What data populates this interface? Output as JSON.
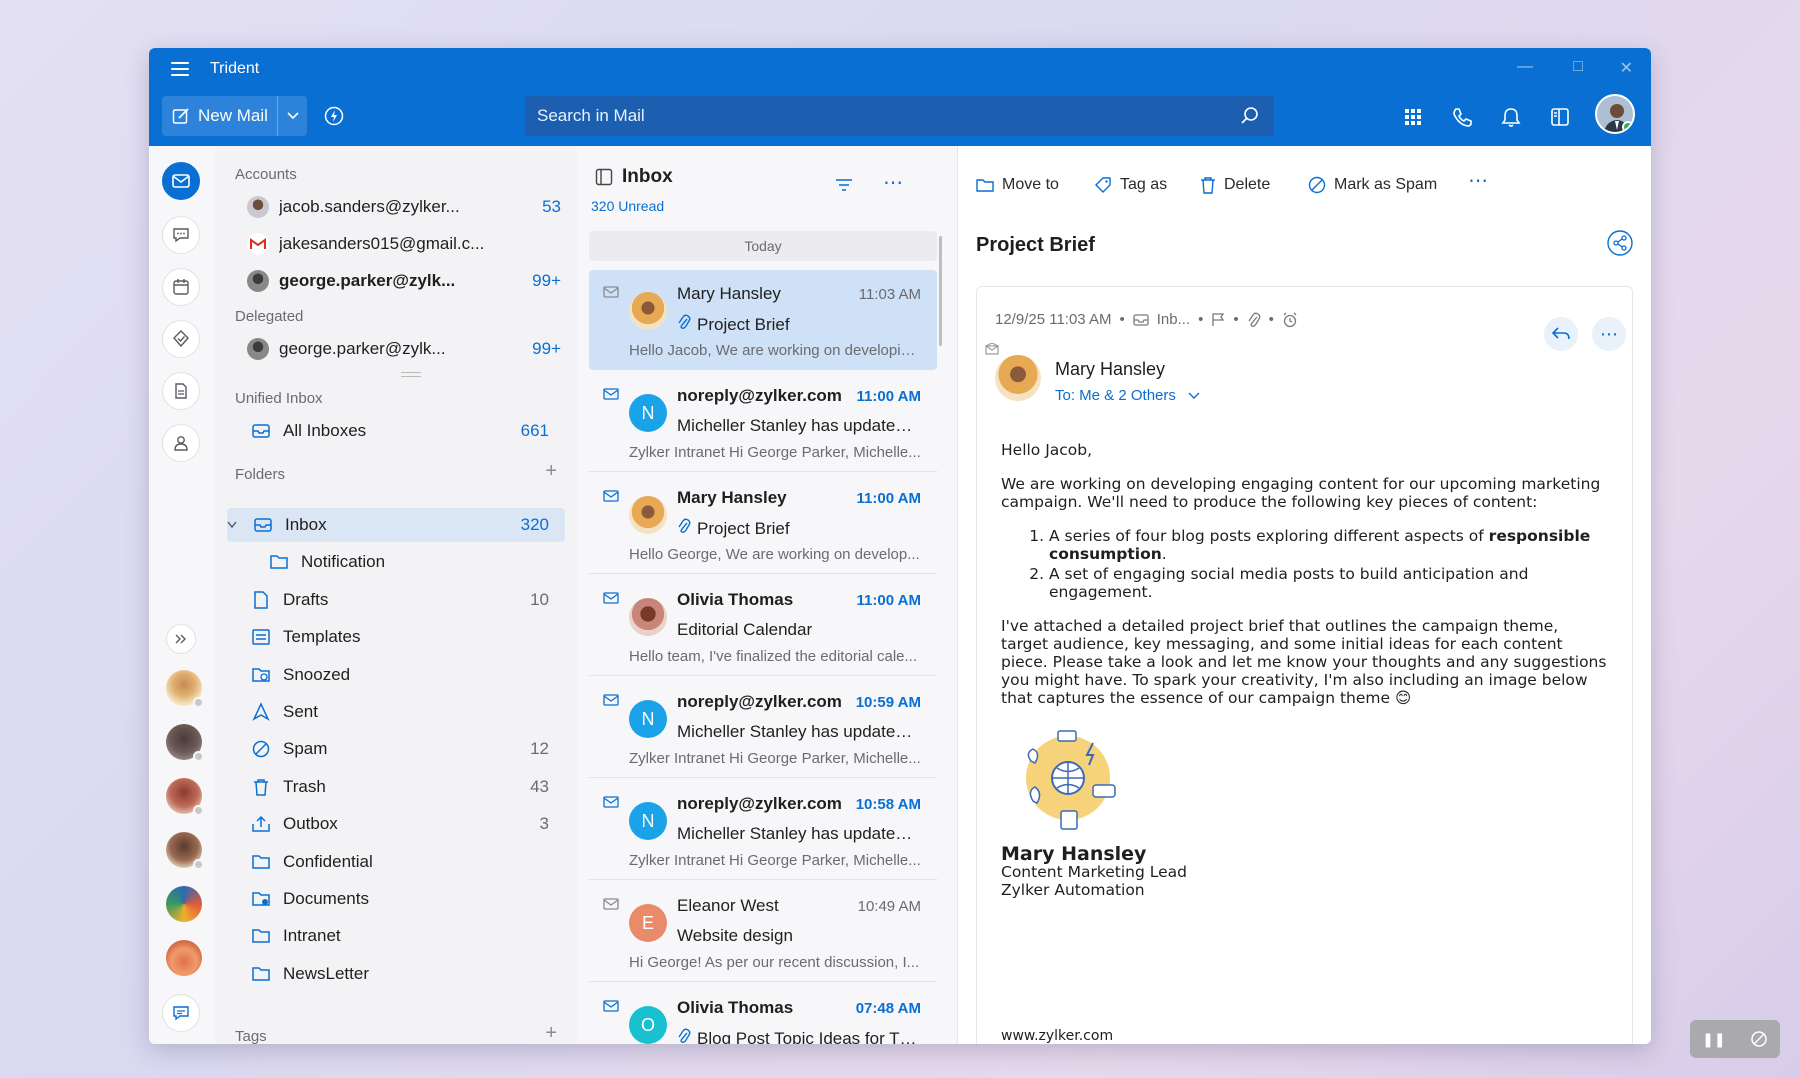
{
  "app": {
    "title": "Trident"
  },
  "toolbar": {
    "new_mail_label": "New Mail",
    "search_placeholder": "Search in Mail"
  },
  "accounts": {
    "heading": "Accounts",
    "items": [
      {
        "email": "jacob.sanders@zylker...",
        "count": "53"
      },
      {
        "email": "jakesanders015@gmail.c...",
        "count": ""
      },
      {
        "email": "george.parker@zylk...",
        "count": "99+"
      }
    ]
  },
  "delegated": {
    "heading": "Delegated",
    "items": [
      {
        "email": "george.parker@zylk...",
        "count": "99+"
      }
    ]
  },
  "unified": {
    "heading": "Unified Inbox",
    "all_label": "All Inboxes",
    "all_count": "661"
  },
  "folders": {
    "heading": "Folders",
    "items": [
      {
        "label": "Inbox",
        "count": "320"
      },
      {
        "label": "Notification",
        "count": ""
      },
      {
        "label": "Drafts",
        "count": "10"
      },
      {
        "label": "Templates",
        "count": ""
      },
      {
        "label": "Snoozed",
        "count": ""
      },
      {
        "label": "Sent",
        "count": ""
      },
      {
        "label": "Spam",
        "count": "12"
      },
      {
        "label": "Trash",
        "count": "43"
      },
      {
        "label": "Outbox",
        "count": "3"
      },
      {
        "label": "Confidential",
        "count": ""
      },
      {
        "label": "Documents",
        "count": ""
      },
      {
        "label": "Intranet",
        "count": ""
      },
      {
        "label": "NewsLetter",
        "count": ""
      }
    ]
  },
  "tags": {
    "heading": "Tags"
  },
  "list": {
    "title": "Inbox",
    "unread": "320 Unread",
    "group": "Today",
    "messages": [
      {
        "from": "Mary Hansley",
        "time": "11:03 AM",
        "subject": "Project Brief",
        "preview": "Hello Jacob, We are working on developin...",
        "initial": ""
      },
      {
        "from": "noreply@zylker.com",
        "time": "11:00 AM",
        "subject": "Micheller Stanley has updated a...",
        "preview": "Zylker Intranet Hi George Parker, Michelle...",
        "initial": "N"
      },
      {
        "from": "Mary Hansley",
        "time": "11:00 AM",
        "subject": "Project Brief",
        "preview": "Hello George, We are working on develop...",
        "initial": ""
      },
      {
        "from": "Olivia Thomas",
        "time": "11:00 AM",
        "subject": "Editorial Calendar",
        "preview": "Hello team, I've finalized the editorial cale...",
        "initial": ""
      },
      {
        "from": "noreply@zylker.com",
        "time": "10:59 AM",
        "subject": "Micheller Stanley has updated a...",
        "preview": "Zylker Intranet Hi George Parker, Michelle...",
        "initial": "N"
      },
      {
        "from": "noreply@zylker.com",
        "time": "10:58 AM",
        "subject": "Micheller Stanley has updated a...",
        "preview": "Zylker Intranet Hi George Parker, Michelle...",
        "initial": "N"
      },
      {
        "from": "Eleanor West",
        "time": "10:49 AM",
        "subject": "Website design",
        "preview": "Hi George! As per our recent discussion, I...",
        "initial": "E"
      },
      {
        "from": "Olivia Thomas",
        "time": "07:48 AM",
        "subject": "Blog Post Topic Ideas for Thi...",
        "preview": "",
        "initial": "O"
      }
    ]
  },
  "reader": {
    "actions": {
      "move": "Move to",
      "tag": "Tag as",
      "delete": "Delete",
      "spam": "Mark as Spam"
    },
    "subject": "Project Brief",
    "date": "12/9/25 11:03 AM",
    "folder": "Inb...",
    "sender": "Mary Hansley",
    "to": "To: Me & 2 Others",
    "greeting": "Hello Jacob,",
    "para1": "We are working on developing engaging content for our upcoming marketing campaign. We'll need to produce the following key pieces of content:",
    "item1_a": "A series of four blog posts exploring different aspects of ",
    "item1_b": "responsible consumption",
    "item1_c": ".",
    "item2": "A set of engaging social media posts to build anticipation and engagement.",
    "para2": "I've attached a detailed project brief that outlines the campaign theme, target audience, key messaging, and some initial ideas for each content piece. Please take a look and let me know your thoughts and any suggestions you might have. To spark your creativity, I'm also including an image below that captures the essence of our campaign theme 😊",
    "sig_name": "Mary Hansley",
    "sig_title": "Content Marketing Lead",
    "sig_company": "Zylker Automation",
    "website": "www.zylker.com"
  },
  "colors": {
    "accent": "#0a6fd3",
    "selected": "#cfe1f6"
  }
}
